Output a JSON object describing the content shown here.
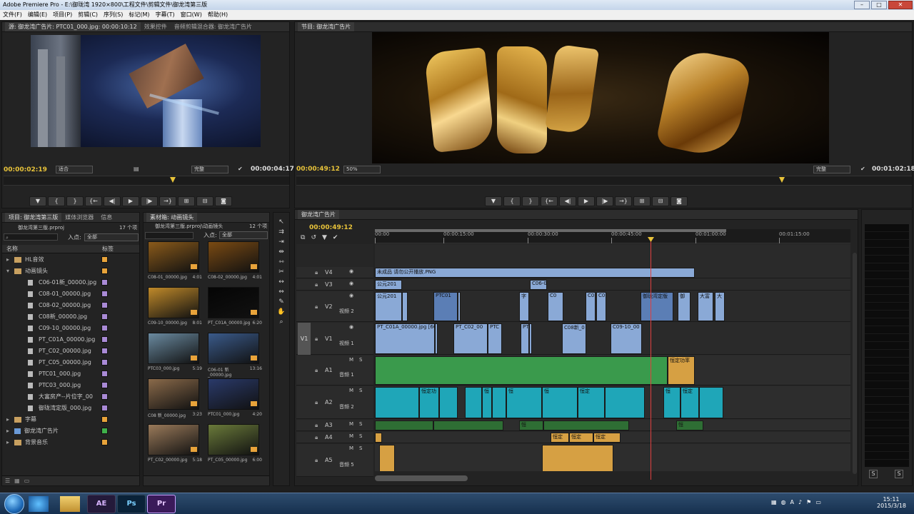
{
  "window": {
    "title": "Adobe Premiere Pro - E:\\御珑湾 1920×800\\工程文件\\剪辑文件\\御龙湾第三版"
  },
  "menu": [
    "文件(F)",
    "编辑(E)",
    "项目(P)",
    "剪辑(C)",
    "序列(S)",
    "标记(M)",
    "字幕(T)",
    "窗口(W)",
    "帮助(H)"
  ],
  "source_monitor": {
    "tabs": [
      "源: 御龙湾广告片: PTC01_000.jpg: 00:00:10:12",
      "效果控件",
      "音频剪辑混合器: 御龙湾广告片"
    ],
    "timecode_left": "00:00:02:19",
    "fit": "适合",
    "quality": "完整",
    "timecode_right": "00:00:04:17"
  },
  "program_monitor": {
    "tab": "节目: 御龙湾广告片",
    "timecode_left": "00:00:49:12",
    "zoom": "50%",
    "quality": "完整",
    "timecode_right": "00:01:02:18"
  },
  "transport_icons": [
    "marker-icon",
    "mark-in-icon",
    "mark-out-icon",
    "go-to-in-icon",
    "step-back-icon",
    "play-icon",
    "step-forward-icon",
    "go-to-out-icon",
    "insert-icon",
    "overwrite-icon",
    "export-frame-icon"
  ],
  "transport_glyphs": [
    "▼",
    "{",
    "}",
    "{←",
    "◀|",
    "▶",
    "|▶",
    "→}",
    "⊞",
    "⊟",
    "◙"
  ],
  "project_panel": {
    "tabs": [
      "项目: 御龙湾第三版",
      "媒体浏览器",
      "信息"
    ],
    "project_name": "御龙湾第三版.prproj",
    "item_count": "17 个项",
    "in_point_label": "入点:",
    "in_point_value": "全部",
    "col_name": "名称",
    "col_label": "标签",
    "items": [
      {
        "name": "HL音效",
        "type": "folder",
        "indent": 0,
        "color": "#e8a33a"
      },
      {
        "name": "动画镜头",
        "type": "folder-open",
        "indent": 0,
        "color": "#e8a33a"
      },
      {
        "name": "C06-01新_00000.jpg",
        "type": "file",
        "indent": 1,
        "color": "#a98ad6"
      },
      {
        "name": "C08-01_00000.jpg",
        "type": "file",
        "indent": 1,
        "color": "#a98ad6"
      },
      {
        "name": "C08-02_00000.jpg",
        "type": "file",
        "indent": 1,
        "color": "#a98ad6"
      },
      {
        "name": "C08新_00000.jpg",
        "type": "file",
        "indent": 1,
        "color": "#a98ad6"
      },
      {
        "name": "C09-10_00000.jpg",
        "type": "file",
        "indent": 1,
        "color": "#a98ad6"
      },
      {
        "name": "PT_C01A_00000.jpg",
        "type": "file",
        "indent": 1,
        "color": "#a98ad6"
      },
      {
        "name": "PT_C02_00000.jpg",
        "type": "file",
        "indent": 1,
        "color": "#a98ad6"
      },
      {
        "name": "PT_C05_00000.jpg",
        "type": "file",
        "indent": 1,
        "color": "#a98ad6"
      },
      {
        "name": "PTC01_000.jpg",
        "type": "file",
        "indent": 1,
        "color": "#a98ad6"
      },
      {
        "name": "PTC03_000.jpg",
        "type": "file",
        "indent": 1,
        "color": "#a98ad6"
      },
      {
        "name": "大富房产--片位字_00",
        "type": "file",
        "indent": 1,
        "color": "#a98ad6"
      },
      {
        "name": "御珑湾定版_000.jpg",
        "type": "file",
        "indent": 1,
        "color": "#a98ad6"
      },
      {
        "name": "字幕",
        "type": "folder",
        "indent": 0,
        "color": "#e8a33a"
      },
      {
        "name": "御龙湾广告片",
        "type": "sequence",
        "indent": 0,
        "color": "#3fb04a"
      },
      {
        "name": "背景音乐",
        "type": "folder",
        "indent": 0,
        "color": "#e8a33a"
      }
    ]
  },
  "bin_panel": {
    "tab": "素材箱: 动画镜头",
    "path": "御龙湾第三版.prproj\\动画镜头",
    "item_count": "12 个项",
    "in_point_label": "入点:",
    "in_point_value": "全部",
    "thumbs": [
      {
        "name": "C08-01_00000.jpg",
        "dur": "4:01",
        "color": "#8a5a1a"
      },
      {
        "name": "C08-02_00000.jpg",
        "dur": "4:01",
        "color": "#7a4a12"
      },
      {
        "name": "C09-10_00000.jpg",
        "dur": "8:01",
        "color": "#c08a2a"
      },
      {
        "name": "PT_C01A_00000.jpg",
        "dur": "6:20",
        "color": "#050505"
      },
      {
        "name": "PTC03_000.jpg",
        "dur": "5:19",
        "color": "#6a8aa0"
      },
      {
        "name": "C06-01 新_00000.jpg",
        "dur": "13:16",
        "color": "#3a5a8a"
      },
      {
        "name": "C08 新_00000.jpg",
        "dur": "3:23",
        "color": "#8a6a4a"
      },
      {
        "name": "PTC01_000.jpg",
        "dur": "4:20",
        "color": "#2a3a6a"
      },
      {
        "name": "PT_C02_00000.jpg",
        "dur": "5:18",
        "color": "#9a7a5a"
      },
      {
        "name": "PT_C05_00000.jpg",
        "dur": "6:00",
        "color": "#6a7a3a"
      }
    ]
  },
  "tools": [
    "selection-tool-icon",
    "track-select-icon",
    "ripple-edit-icon",
    "rolling-edit-icon",
    "rate-stretch-icon",
    "razor-icon",
    "slip-icon",
    "slide-icon",
    "pen-icon",
    "hand-icon",
    "zoom-icon"
  ],
  "tool_glyphs": [
    "↖",
    "⇉",
    "⇥",
    "⇹",
    "⇿",
    "✂",
    "↔",
    "⇔",
    "✎",
    "✋",
    "⌕"
  ],
  "timeline": {
    "tab": "御龙湾广告片",
    "timecode": "00:00:49:12",
    "ruler_labels": [
      "00:00",
      "00:00:15:00",
      "00:00:30:00",
      "00:00:45:00",
      "00:01:00:00",
      "00:01:15:00"
    ],
    "tracks": [
      {
        "id": "V4",
        "name": ""
      },
      {
        "id": "V3",
        "name": ""
      },
      {
        "id": "V2",
        "name": "视频 2"
      },
      {
        "id": "V1",
        "name": "视频 1"
      },
      {
        "id": "A1",
        "name": "音频 1"
      },
      {
        "id": "A2",
        "name": "音频 2"
      },
      {
        "id": "A3",
        "name": ""
      },
      {
        "id": "A4",
        "name": ""
      },
      {
        "id": "A5",
        "name": "音频 5"
      }
    ],
    "source_patch": "V1",
    "clip_labels": {
      "v4_main": "未成品 请勿公开播放.PNG",
      "v3_a": "公元201",
      "v3_b": "C06-0",
      "v2_a": "公元201",
      "v2_b": "PTC01",
      "v2_c": "字",
      "v2_d": "C0",
      "v2_e": "C0",
      "v2_f": "C0",
      "v2_g": "御珑湾定版",
      "v2_h": "御",
      "v2_i": "大富",
      "v2_j": "大",
      "v1_a": "PT_C01A_00000.jpg [609",
      "v1_b": "PT_C02_00",
      "v1_c": "PTC",
      "v1_d": "PT",
      "v1_e": "C08新_0",
      "v1_f": "C09-10_00",
      "a1_end": "恒定功率",
      "a2_a": "恒定功",
      "a2_b": "恒",
      "a2_c": "恒",
      "a2_d": "恒",
      "a2_e": "恒定",
      "a2_f": "恒",
      "a2_g": "恒定",
      "a3_a": "恒",
      "a3_b": "恒",
      "a4_a": "恒定",
      "a4_b": "恒定",
      "a4_c": "恒定"
    }
  },
  "meter": {
    "solo_labels": [
      "S",
      "S"
    ]
  },
  "taskbar": {
    "apps": [
      "AE",
      "Ps",
      "Pr"
    ],
    "time": "15:11",
    "date": "2015/3/18"
  }
}
